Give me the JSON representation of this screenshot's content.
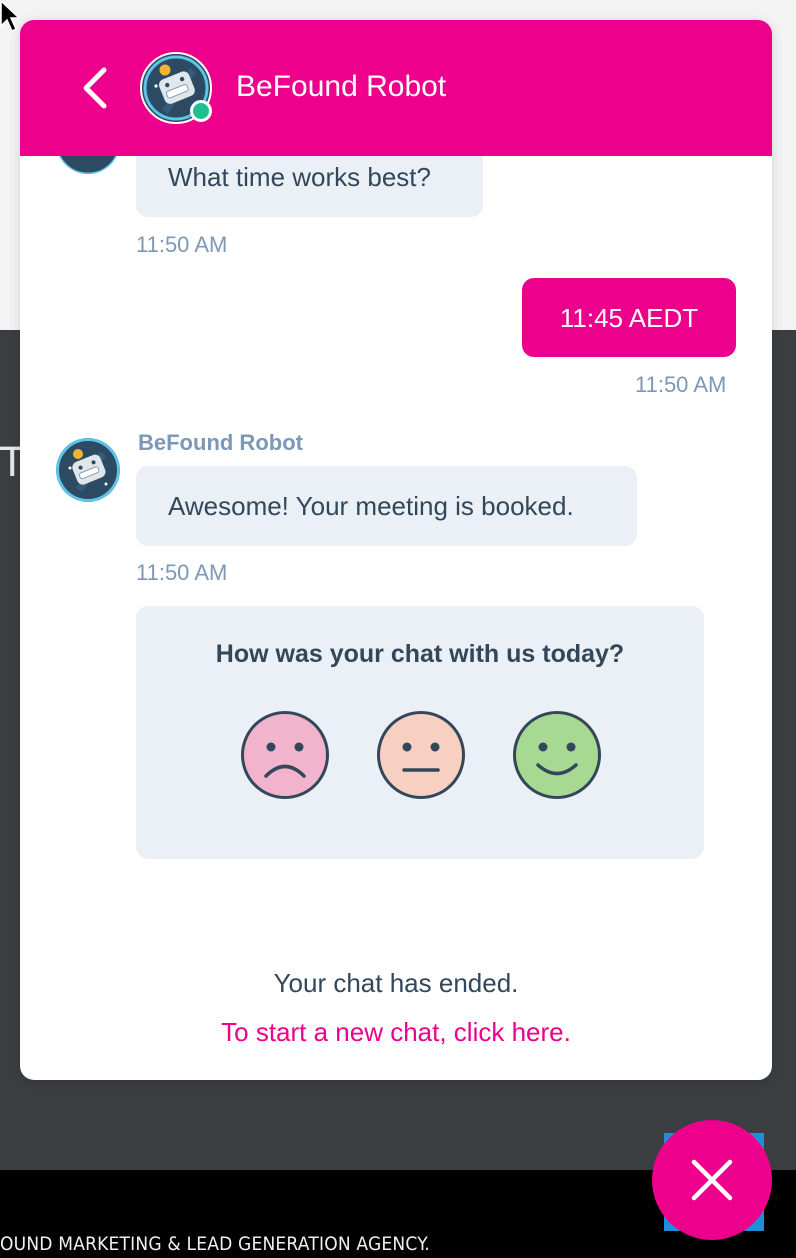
{
  "header": {
    "title": "BeFound Robot",
    "status": "online"
  },
  "messages": [
    {
      "from": "bot",
      "text": "What time works best?",
      "time": "11:50 AM"
    },
    {
      "from": "user",
      "text": "11:45 AEDT",
      "time": "11:50 AM"
    },
    {
      "from": "bot",
      "sender": "BeFound Robot",
      "text": "Awesome! Your meeting is booked.",
      "time": "11:50 AM"
    }
  ],
  "rating": {
    "question": "How was your chat with us today?",
    "options": [
      "sad-face-icon",
      "neutral-face-icon",
      "happy-face-icon"
    ]
  },
  "footer": {
    "ended": "Your chat has ended.",
    "new_chat": "To start a new chat, click here."
  },
  "page": {
    "footer_text": "OUND MARKETING & LEAD GENERATION AGENCY.",
    "edge_glyph": "T"
  },
  "colors": {
    "accent": "#ec008c",
    "bubble_bg": "#eaf0f6",
    "text": "#33475b",
    "muted": "#7c98b6",
    "online": "#1fbf8f"
  }
}
